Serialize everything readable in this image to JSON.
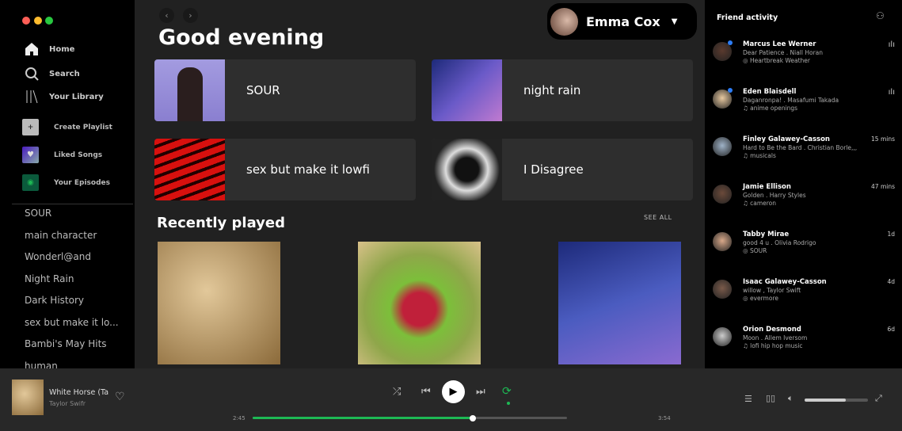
{
  "window": {
    "controls": [
      "close",
      "minimize",
      "maximize"
    ]
  },
  "sidebar": {
    "nav": [
      {
        "label": "Home",
        "icon": "home-icon"
      },
      {
        "label": "Search",
        "icon": "search-icon"
      },
      {
        "label": "Your Library",
        "icon": "library-icon"
      }
    ],
    "actions": [
      {
        "label": "Create Playlist",
        "icon": "plus-icon"
      },
      {
        "label": "Liked Songs",
        "icon": "heart-icon"
      },
      {
        "label": "Your Episodes",
        "icon": "podcast-icon"
      }
    ],
    "playlists": [
      "SOUR",
      "main character",
      "Wonderl@and",
      "Night Rain",
      "Dark History",
      "sex but make it lo...",
      "Bambi's May Hits",
      "human"
    ]
  },
  "header": {
    "greeting": "Good evening",
    "user": "Emma Cox"
  },
  "quick": [
    {
      "title": "SOUR"
    },
    {
      "title": "night rain"
    },
    {
      "title": "sex but make it lowfi"
    },
    {
      "title": "I Disagree"
    }
  ],
  "recent": {
    "title": "Recently played",
    "see_all": "SEE ALL"
  },
  "friends": {
    "title": "Friend activity",
    "items": [
      {
        "name": "Marcus Lee Werner",
        "song": "Dear Patience . Niall Horan",
        "context": "Heartbreak Weather",
        "ctx_type": "album",
        "time": "",
        "playing": true
      },
      {
        "name": "Eden Blaisdell",
        "song": "Daganronpa! . Masafumi Takada",
        "context": "anime openings",
        "ctx_type": "playlist",
        "time": "",
        "playing": true
      },
      {
        "name": "Finley Galawey-Casson",
        "song": "Hard to Be the Bard . Christian Borle,,,",
        "context": "musicals",
        "ctx_type": "playlist",
        "time": "15 mins"
      },
      {
        "name": "Jamie Ellison",
        "song": "Golden . Harry Styles",
        "context": "cameron",
        "ctx_type": "playlist",
        "time": "47 mins"
      },
      {
        "name": "Tabby Mirae",
        "song": "good 4 u . Olivia Rodrigo",
        "context": "SOUR",
        "ctx_type": "album",
        "time": "1d"
      },
      {
        "name": "Isaac Galawey-Casson",
        "song": "willow , Taylor Swift",
        "context": "evermore",
        "ctx_type": "album",
        "time": "4d"
      },
      {
        "name": "Orion Desmond",
        "song": "Moon . Allem Iversom",
        "context": "lofi hip hop music",
        "ctx_type": "playlist",
        "time": "6d"
      }
    ]
  },
  "player": {
    "track": "White Horse (Ta",
    "artist": "Taylor Swifr",
    "elapsed": "2:45",
    "duration": "3:54",
    "progress": 0.7,
    "volume": 0.65,
    "accent": "#1db954"
  }
}
